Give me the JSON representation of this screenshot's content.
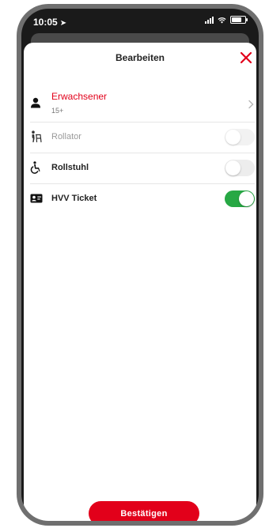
{
  "status_bar": {
    "time": "10:05"
  },
  "sheet": {
    "title": "Bearbeiten",
    "passenger": {
      "type": "Erwachsener",
      "age": "15+"
    },
    "options": {
      "rollator": {
        "label": "Rollator",
        "enabled": false
      },
      "rollstuhl": {
        "label": "Rollstuhl",
        "enabled": false
      },
      "hvv_ticket": {
        "label": "HVV Ticket",
        "enabled": true
      }
    },
    "confirm_label": "Bestätigen"
  },
  "colors": {
    "accent": "#e2001a",
    "toggle_on": "#27a844",
    "toggle_off": "#ededed"
  },
  "icons": {
    "close": "close-icon",
    "passenger": "person-icon",
    "chevron": "chevron-right-icon",
    "rollator": "walker-icon",
    "rollstuhl": "wheelchair-icon",
    "ticket": "id-card-icon"
  }
}
